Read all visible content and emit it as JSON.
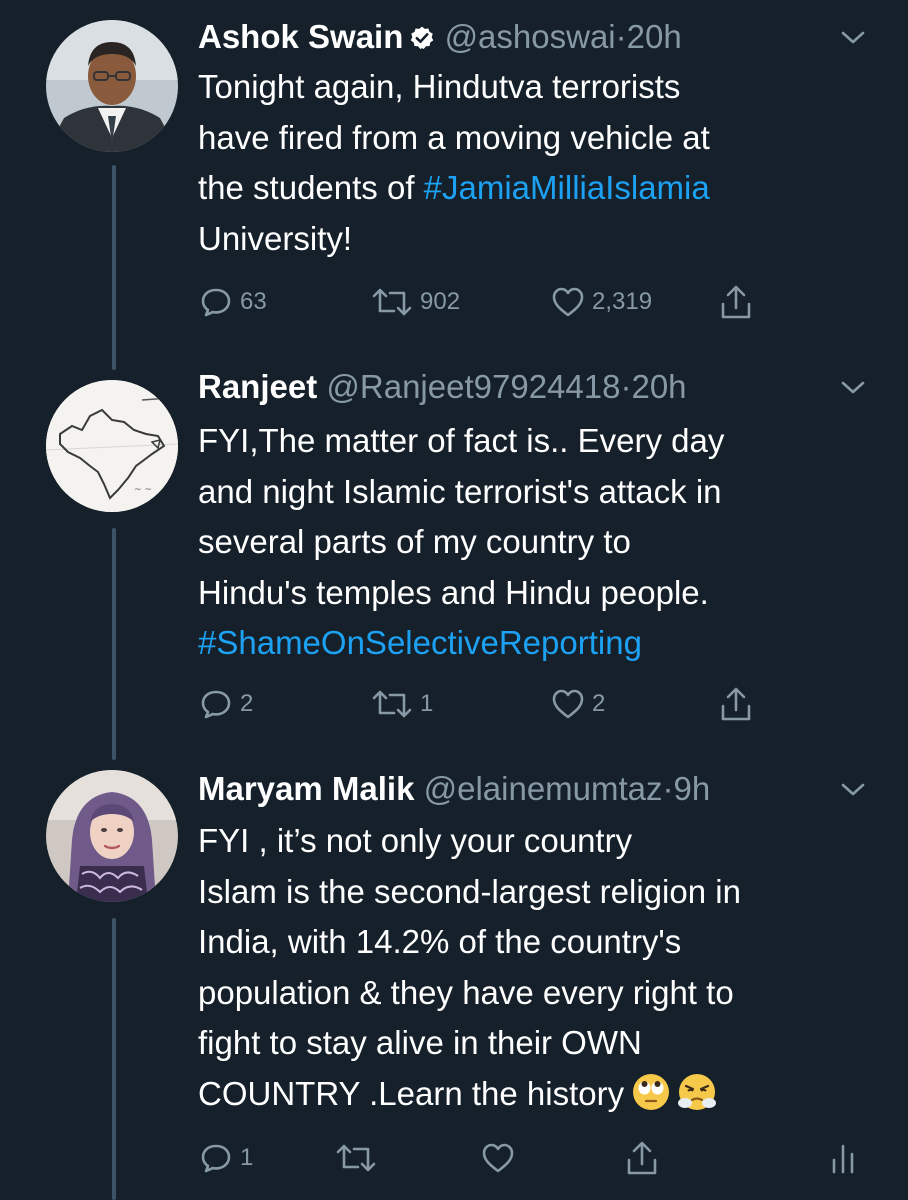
{
  "tweets": [
    {
      "name": "Ashok Swain",
      "verified": true,
      "handle": "@ashoswai",
      "sep": "·",
      "time": "20h",
      "lines": [
        [
          {
            "t": "Tonight again, Hindutva terrorists"
          }
        ],
        [
          {
            "t": "have fired from a moving vehicle at"
          }
        ],
        [
          {
            "t": "the students of "
          },
          {
            "t": "#JamiaMilliaIslamia",
            "tag": true
          }
        ],
        [
          {
            "t": "University!"
          }
        ]
      ],
      "reply_count": "63",
      "retweet_count": "902",
      "like_count": "2,319"
    },
    {
      "name": "Ranjeet",
      "verified": false,
      "handle": "@Ranjeet97924418",
      "sep": "·",
      "time": "20h",
      "lines": [
        [
          {
            "t": "FYI,The matter of fact is.. Every day"
          }
        ],
        [
          {
            "t": "and night Islamic terrorist's attack in"
          }
        ],
        [
          {
            "t": "several parts of my country to"
          }
        ],
        [
          {
            "t": "Hindu's temples and Hindu people."
          }
        ],
        [
          {
            "t": "#ShameOnSelectiveReporting",
            "tag": true
          }
        ]
      ],
      "reply_count": "2",
      "retweet_count": "1",
      "like_count": "2"
    },
    {
      "name": "Maryam Malik",
      "verified": false,
      "handle": "@elainemumtaz",
      "sep": "·",
      "time": "9h",
      "lines": [
        [
          {
            "t": "FYI , it’s not only your country"
          }
        ],
        [
          {
            "t": "Islam is the second-largest religion in"
          }
        ],
        [
          {
            "t": "India, with 14.2% of the country's"
          }
        ],
        [
          {
            "t": "population & they have every right to"
          }
        ],
        [
          {
            "t": "fight to stay alive in their OWN"
          }
        ],
        [
          {
            "t": "COUNTRY .Learn the history"
          },
          {
            "emoji": "face-with-rolling-eyes"
          },
          {
            "emoji": "face-with-steam-from-nose"
          }
        ]
      ],
      "reply_count": "1",
      "retweet_count": "",
      "like_count": ""
    }
  ],
  "colors": {
    "background": "#15202b",
    "text": "#ffffff",
    "muted": "#8899a6",
    "link": "#1da1f2",
    "thread_line": "#3d5466"
  },
  "icons": {
    "reply": "reply-icon",
    "retweet": "retweet-icon",
    "like": "heart-icon",
    "share": "share-icon",
    "analytics": "analytics-icon",
    "more": "chevron-down-icon",
    "verified": "verified-badge-icon"
  }
}
